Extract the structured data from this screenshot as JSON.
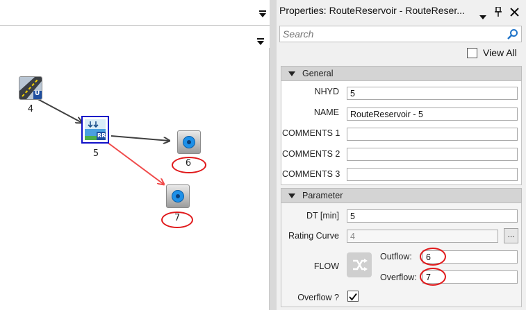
{
  "canvas": {
    "nodes": [
      {
        "label": "4"
      },
      {
        "label": "5"
      },
      {
        "label": "6"
      },
      {
        "label": "7"
      }
    ],
    "badges": {
      "node4": "U",
      "node5": "RR"
    }
  },
  "properties": {
    "title": "Properties: RouteReservoir - RouteReser...",
    "search_placeholder": "Search",
    "view_all_label": "View All",
    "general": {
      "header": "General",
      "fields": [
        {
          "label": "NHYD",
          "value": "5"
        },
        {
          "label": "NAME",
          "value": "RouteReservoir - 5"
        },
        {
          "label": "COMMENTS 1",
          "value": ""
        },
        {
          "label": "COMMENTS 2",
          "value": ""
        },
        {
          "label": "COMMENTS 3",
          "value": ""
        }
      ]
    },
    "parameter": {
      "header": "Parameter",
      "dt_label": "DT [min]",
      "dt_value": "5",
      "rating_curve_label": "Rating Curve",
      "rating_curve_value": "4",
      "browse_label": "...",
      "flow_label": "FLOW",
      "outflow_label": "Outflow:",
      "outflow_value": "6",
      "overflow_label": "Overflow:",
      "overflow_value": "7",
      "overflow_q_label": "Overflow ?",
      "overflow_q_checked": true
    }
  },
  "colors": {
    "link_dark": "#404040",
    "link_red": "#f04b4b",
    "annotation_red": "#e0191b",
    "selection_blue": "#1010c8",
    "node_blue": "#1e90e8"
  }
}
